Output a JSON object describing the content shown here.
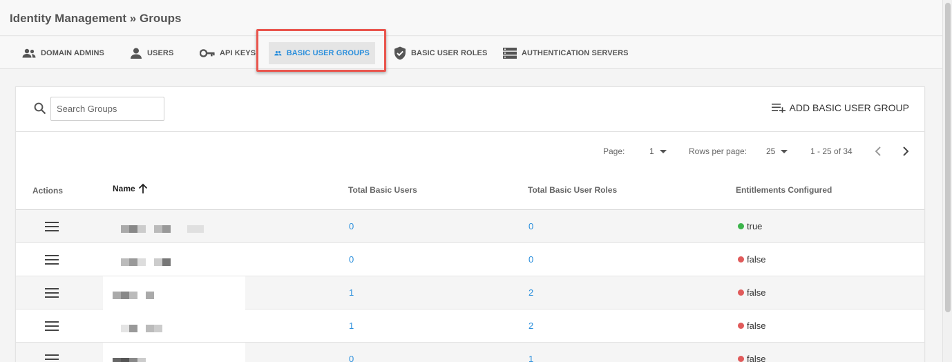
{
  "header": {
    "title": "Identity Management » Groups"
  },
  "tabs": [
    {
      "label": "DOMAIN ADMINS",
      "icon": "admin-group-icon"
    },
    {
      "label": "USERS",
      "icon": "user-icon"
    },
    {
      "label": "API KEYS",
      "icon": "key-icon"
    },
    {
      "label": "BASIC USER GROUPS",
      "icon": "people-icon",
      "active": true
    },
    {
      "label": "BASIC USER ROLES",
      "icon": "shield-check-icon"
    },
    {
      "label": "AUTHENTICATION SERVERS",
      "icon": "server-icon"
    }
  ],
  "toolbar": {
    "search_placeholder": "Search Groups",
    "add_label": "ADD BASIC USER GROUP"
  },
  "pagination": {
    "page_label": "Page:",
    "page_value": "1",
    "rows_label": "Rows per page:",
    "rows_value": "25",
    "range": "1 - 25 of 34"
  },
  "table": {
    "columns": [
      "Actions",
      "Name",
      "Total Basic Users",
      "Total Basic User Roles",
      "Entitlements Configured"
    ],
    "rows": [
      {
        "users": "0",
        "roles": "0",
        "entitlements": "true"
      },
      {
        "users": "0",
        "roles": "0",
        "entitlements": "false"
      },
      {
        "users": "1",
        "roles": "2",
        "entitlements": "false"
      },
      {
        "users": "1",
        "roles": "2",
        "entitlements": "false"
      },
      {
        "users": "0",
        "roles": "1",
        "entitlements": "false"
      }
    ]
  },
  "colors": {
    "accent": "#2b8fdc",
    "true_dot": "#3cb44b",
    "false_dot": "#e05a5a",
    "highlight": "#e9554d"
  }
}
